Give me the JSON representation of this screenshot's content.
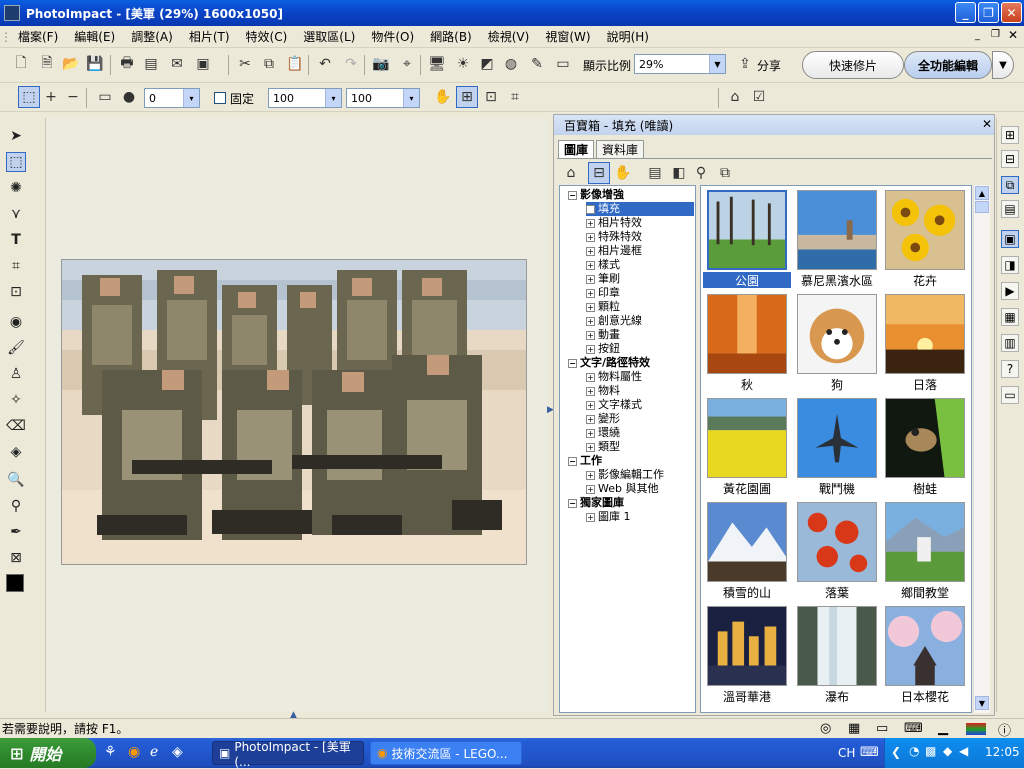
{
  "window": {
    "title": "PhotoImpact - [美軍 (29%) 1600x1050]",
    "buttons": [
      "minimize",
      "restore",
      "close"
    ]
  },
  "menu": [
    "檔案(F)",
    "編輯(E)",
    "調整(A)",
    "相片(T)",
    "特效(C)",
    "選取區(L)",
    "物件(O)",
    "網路(B)",
    "檢視(V)",
    "視窗(W)",
    "說明(H)"
  ],
  "toolbar": {
    "zoom_label": "顯示比例",
    "zoom_value": "29%",
    "share_label": "分享",
    "quick_fix_label": "快速修片",
    "full_edit_label": "全功能編輯"
  },
  "attrbar": {
    "soft_value": "0",
    "fixed_label": "固定",
    "width_value": "100",
    "height_value": "100"
  },
  "colors": {
    "foreground": "#000000",
    "background": "#ffffff",
    "accent": "#316ac5"
  },
  "panel": {
    "title": "百寶箱 - 填充 (唯讀)",
    "tabs": [
      "圖庫",
      "資料庫"
    ],
    "tree": [
      {
        "label": "影像增強",
        "level": 0,
        "box": "−",
        "bold": true
      },
      {
        "label": "填充",
        "level": 1,
        "box": "+",
        "selected": true
      },
      {
        "label": "相片特效",
        "level": 1,
        "box": "+"
      },
      {
        "label": "特殊特效",
        "level": 1,
        "box": "+"
      },
      {
        "label": "相片邊框",
        "level": 1,
        "box": "+"
      },
      {
        "label": "樣式",
        "level": 1,
        "box": "+"
      },
      {
        "label": "筆刷",
        "level": 1,
        "box": "+"
      },
      {
        "label": "印章",
        "level": 1,
        "box": "+"
      },
      {
        "label": "顆粒",
        "level": 1,
        "box": "+"
      },
      {
        "label": "創意光線",
        "level": 1,
        "box": "+"
      },
      {
        "label": "動畫",
        "level": 1,
        "box": "+"
      },
      {
        "label": "按鈕",
        "level": 1,
        "box": "+"
      },
      {
        "label": "文字/路徑特效",
        "level": 0,
        "box": "−",
        "bold": true
      },
      {
        "label": "物料屬性",
        "level": 1,
        "box": "+"
      },
      {
        "label": "物料",
        "level": 1,
        "box": "+"
      },
      {
        "label": "文字樣式",
        "level": 1,
        "box": "+"
      },
      {
        "label": "變形",
        "level": 1,
        "box": "+"
      },
      {
        "label": "環繞",
        "level": 1,
        "box": "+"
      },
      {
        "label": "類型",
        "level": 1,
        "box": "+"
      },
      {
        "label": "工作",
        "level": 0,
        "box": "−",
        "bold": true
      },
      {
        "label": "影像編輯工作",
        "level": 1,
        "box": "+"
      },
      {
        "label": "Web 與其他",
        "level": 1,
        "box": "+"
      },
      {
        "label": "獨家圖庫",
        "level": 0,
        "box": "−",
        "bold": true
      },
      {
        "label": "圖庫 1",
        "level": 1,
        "box": "+"
      }
    ],
    "gallery": [
      "公園",
      "慕尼黑濱水區",
      "花卉",
      "秋",
      "狗",
      "日落",
      "黃花園圃",
      "戰鬥機",
      "樹蛙",
      "積雪的山",
      "落葉",
      "鄉間教堂",
      "溫哥華港",
      "瀑布",
      "日本櫻花"
    ]
  },
  "status": {
    "help_text": "若需要說明，請按 F1。"
  },
  "taskbar": {
    "start_label": "開始",
    "tasks": [
      "PhotoImpact - [美軍 (...",
      "技術交流區 - LEGO..."
    ],
    "lang": "CH",
    "clock": "12:05"
  }
}
